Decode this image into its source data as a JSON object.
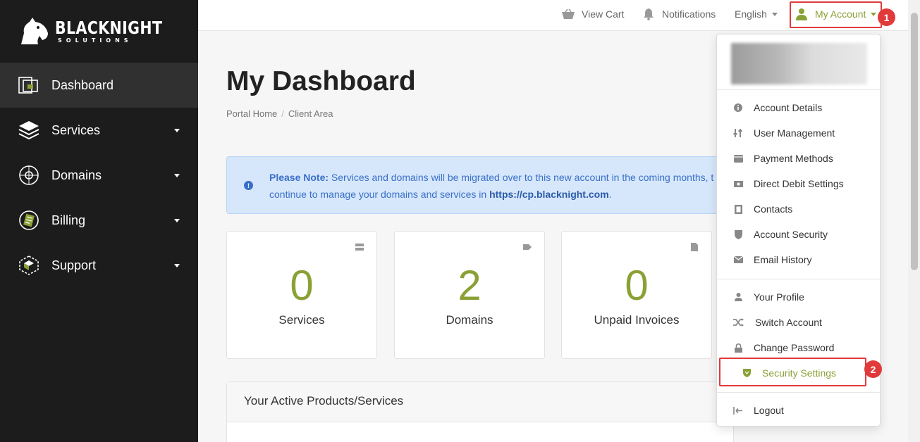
{
  "brand": {
    "name": "BLACKNIGHT",
    "tagline": "SOLUTIONS"
  },
  "sidebar": {
    "items": [
      {
        "label": "Dashboard",
        "icon": "dashboard-icon",
        "active": true
      },
      {
        "label": "Services",
        "icon": "services-icon"
      },
      {
        "label": "Domains",
        "icon": "domains-icon"
      },
      {
        "label": "Billing",
        "icon": "billing-icon"
      },
      {
        "label": "Support",
        "icon": "support-icon"
      }
    ]
  },
  "topbar": {
    "view_cart": "View Cart",
    "notifications": "Notifications",
    "language": "English",
    "account": "My Account"
  },
  "annotations": {
    "step1": "1",
    "step2": "2",
    "highlight_color": "#e03a3a"
  },
  "page": {
    "title": "My Dashboard",
    "breadcrumb": [
      "Portal Home",
      "Client Area"
    ]
  },
  "alert": {
    "bold": "Please Note:",
    "line1": " Services and domains will be migrated over to this new account in the coming months, t",
    "line2_prefix": "continue to manage your domains and services in ",
    "link": "https://cp.blacknight.com",
    "line2_suffix": "."
  },
  "stats": [
    {
      "value": "0",
      "label": "Services",
      "icon": "server-icon"
    },
    {
      "value": "2",
      "label": "Domains",
      "icon": "tag-icon"
    },
    {
      "value": "0",
      "label": "Unpaid Invoices",
      "icon": "file-icon"
    }
  ],
  "panel": {
    "title": "Your Active Products/Services"
  },
  "account_menu": {
    "group1": [
      {
        "label": "Account Details",
        "icon": "info-icon"
      },
      {
        "label": "User Management",
        "icon": "sliders-icon"
      },
      {
        "label": "Payment Methods",
        "icon": "credit-card-icon"
      },
      {
        "label": "Direct Debit Settings",
        "icon": "money-icon"
      },
      {
        "label": "Contacts",
        "icon": "contact-card-icon"
      },
      {
        "label": "Account Security",
        "icon": "shield-icon"
      },
      {
        "label": "Email History",
        "icon": "envelope-icon"
      }
    ],
    "group2": [
      {
        "label": "Your Profile",
        "icon": "user-icon"
      },
      {
        "label": "Switch Account",
        "icon": "shuffle-icon"
      },
      {
        "label": "Change Password",
        "icon": "lock-icon"
      },
      {
        "label": "Security Settings",
        "icon": "shield-icon",
        "active": true
      }
    ],
    "logout": {
      "label": "Logout",
      "icon": "logout-icon"
    }
  },
  "colors": {
    "accent_green": "#8aa136",
    "sidebar_bg": "#1c1c1c",
    "alert_blue": "#3a6fc9"
  }
}
